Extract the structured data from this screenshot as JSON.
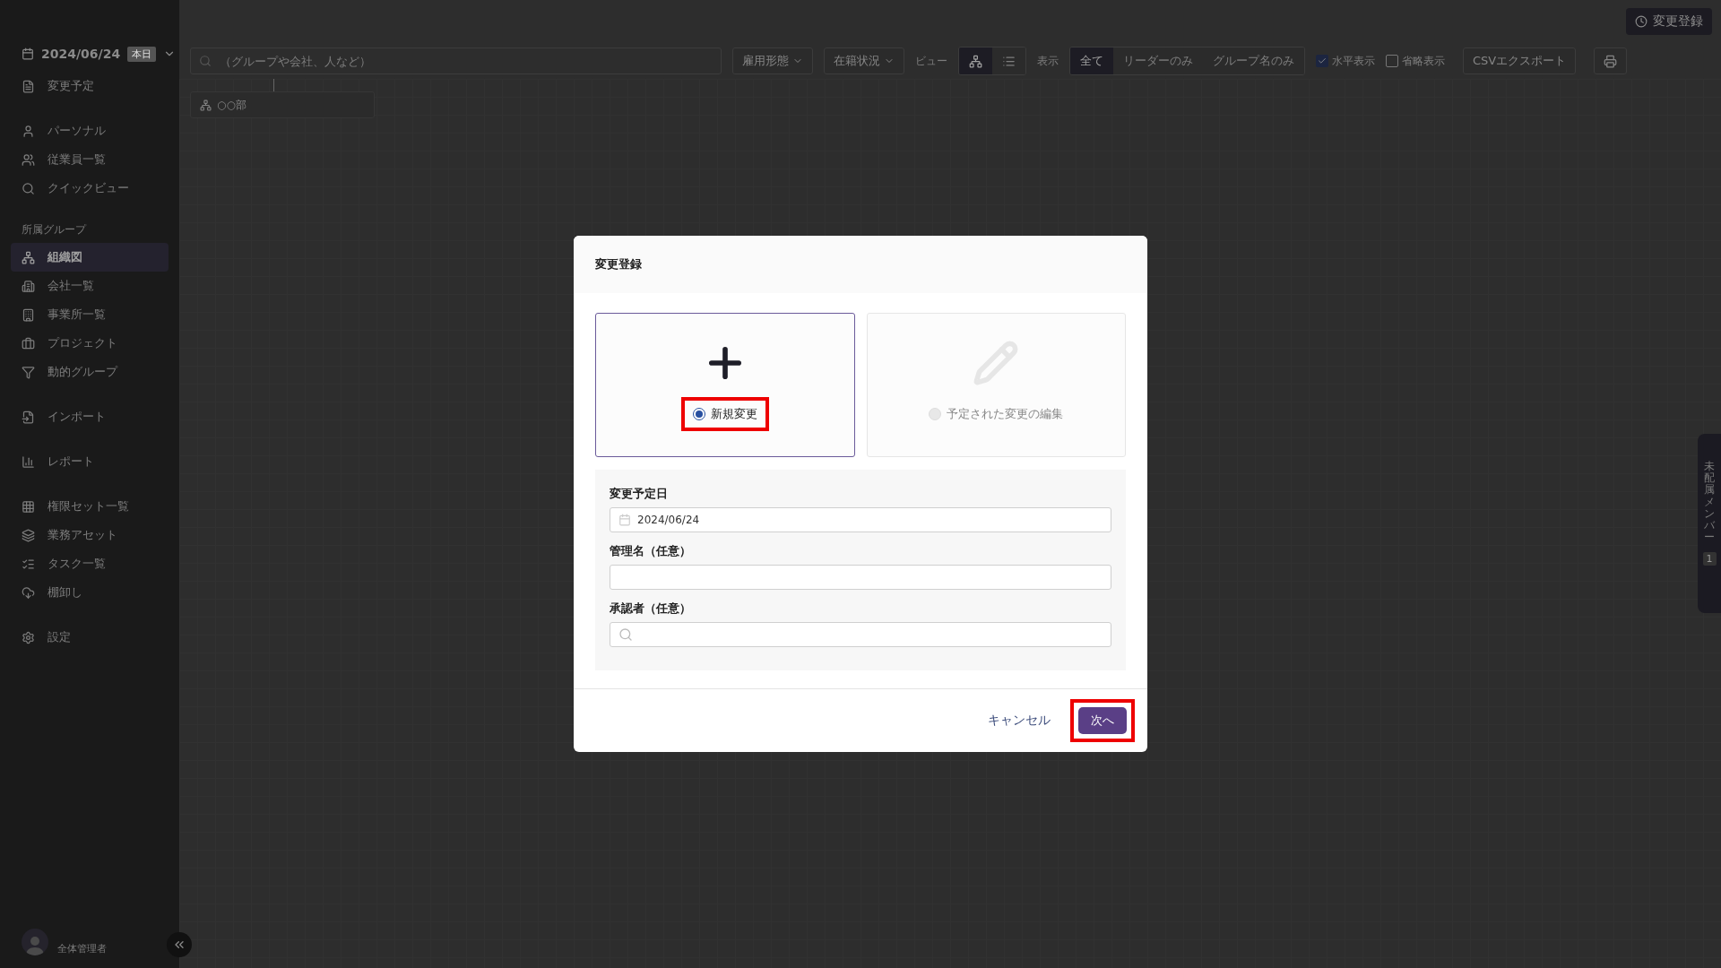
{
  "sidebar": {
    "date": "2024/06/24",
    "date_badge": "本日",
    "groups": [
      {
        "items": [
          {
            "label": "変更予定",
            "selected": false
          }
        ]
      },
      {
        "items": [
          {
            "label": "パーソナル",
            "selected": false
          },
          {
            "label": "従業員一覧",
            "selected": false
          },
          {
            "label": "クイックビュー",
            "selected": false
          }
        ]
      },
      {
        "heading": "所属グループ",
        "items": [
          {
            "label": "組織図",
            "selected": true
          },
          {
            "label": "会社一覧",
            "selected": false
          },
          {
            "label": "事業所一覧",
            "selected": false
          },
          {
            "label": "プロジェクト",
            "selected": false
          },
          {
            "label": "動的グループ",
            "selected": false
          }
        ]
      },
      {
        "items": [
          {
            "label": "インポート",
            "selected": false
          }
        ]
      },
      {
        "items": [
          {
            "label": "レポート",
            "selected": false
          }
        ]
      },
      {
        "items": [
          {
            "label": "権限セット一覧",
            "selected": false
          },
          {
            "label": "業務アセット",
            "selected": false
          },
          {
            "label": "タスク一覧",
            "selected": false
          },
          {
            "label": "棚卸し",
            "selected": false
          }
        ]
      },
      {
        "items": [
          {
            "label": "設定",
            "selected": false
          }
        ]
      }
    ],
    "user": {
      "role": "全体管理者"
    }
  },
  "header": {
    "button": "変更登録"
  },
  "toolbar": {
    "search": {
      "placeholder": "（グループや会社、人など）"
    },
    "filters": [
      "雇用形態",
      "在籍状況"
    ],
    "view": {
      "label": "ビュー",
      "options": [
        {
          "kind": "org",
          "selected": true
        },
        {
          "kind": "list",
          "selected": false
        }
      ]
    },
    "display": {
      "label": "表示",
      "options": [
        {
          "label": "全て",
          "selected": true
        },
        {
          "label": "リーダーのみ",
          "selected": false
        },
        {
          "label": "グループ名のみ",
          "selected": false
        }
      ]
    },
    "checkboxes": [
      {
        "label": "水平表示",
        "checked": true
      },
      {
        "label": "省略表示",
        "checked": false
      }
    ],
    "export": "CSVエクスポート"
  },
  "canvas": {
    "nodes": [
      {
        "label": "○○部"
      }
    ]
  },
  "side_tab": {
    "label": "未配属メンバー",
    "count": "1"
  },
  "modal": {
    "title": "変更登録",
    "options": [
      {
        "kind": "new",
        "label": "新規変更",
        "selected": true,
        "highlighted": true
      },
      {
        "kind": "edit",
        "label": "予定された変更の編集",
        "selected": false,
        "highlighted": false
      }
    ],
    "fields": [
      {
        "kind": "date",
        "label": "変更予定日",
        "value": "2024/06/24"
      },
      {
        "kind": "text",
        "label": "管理名（任意）"
      },
      {
        "kind": "search",
        "label": "承認者（任意）"
      }
    ],
    "cancel": "キャンセル",
    "next": {
      "label": "次へ",
      "highlighted": true
    }
  }
}
